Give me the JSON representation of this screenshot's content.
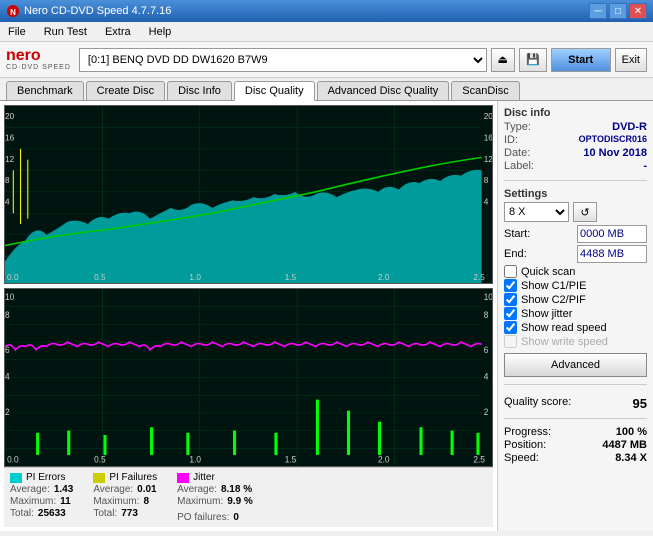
{
  "titlebar": {
    "title": "Nero CD-DVD Speed 4.7.7.16",
    "minimize": "─",
    "maximize": "□",
    "close": "✕"
  },
  "menubar": {
    "items": [
      "File",
      "Run Test",
      "Extra",
      "Help"
    ]
  },
  "toolbar": {
    "logo_main": "nero",
    "logo_sub": "CD·DVD SPEED",
    "drive_value": "[0:1]  BENQ DVD DD DW1620 B7W9",
    "start_label": "Start",
    "exit_label": "Exit"
  },
  "tabs": [
    {
      "label": "Benchmark",
      "active": false
    },
    {
      "label": "Create Disc",
      "active": false
    },
    {
      "label": "Disc Info",
      "active": false
    },
    {
      "label": "Disc Quality",
      "active": true
    },
    {
      "label": "Advanced Disc Quality",
      "active": false
    },
    {
      "label": "ScanDisc",
      "active": false
    }
  ],
  "disc_info": {
    "section": "Disc info",
    "type_key": "Type:",
    "type_val": "DVD-R",
    "id_key": "ID:",
    "id_val": "OPTODISCR016",
    "date_key": "Date:",
    "date_val": "10 Nov 2018",
    "label_key": "Label:",
    "label_val": "-"
  },
  "settings": {
    "section": "Settings",
    "speed": "8 X",
    "start_key": "Start:",
    "start_val": "0000 MB",
    "end_key": "End:",
    "end_val": "4488 MB",
    "quick_scan": "Quick scan",
    "show_c1pie": "Show C1/PIE",
    "show_c2pif": "Show C2/PIF",
    "show_jitter": "Show jitter",
    "show_read_speed": "Show read speed",
    "show_write_speed": "Show write speed",
    "advanced_btn": "Advanced"
  },
  "quality": {
    "score_label": "Quality score:",
    "score_val": "95"
  },
  "progress": {
    "progress_key": "Progress:",
    "progress_val": "100 %",
    "position_key": "Position:",
    "position_val": "4487 MB",
    "speed_key": "Speed:",
    "speed_val": "8.34 X"
  },
  "stats": {
    "pi_errors": {
      "label": "PI Errors",
      "color": "#00cccc",
      "avg_key": "Average:",
      "avg_val": "1.43",
      "max_key": "Maximum:",
      "max_val": "11",
      "total_key": "Total:",
      "total_val": "25633"
    },
    "pi_failures": {
      "label": "PI Failures",
      "color": "#cccc00",
      "avg_key": "Average:",
      "avg_val": "0.01",
      "max_key": "Maximum:",
      "max_val": "8",
      "total_key": "Total:",
      "total_val": "773"
    },
    "jitter": {
      "label": "Jitter",
      "color": "#ff00ff",
      "avg_key": "Average:",
      "avg_val": "8.18 %",
      "max_key": "Maximum:",
      "max_val": "9.9 %"
    },
    "po_failures": {
      "label": "PO failures:",
      "val": "0"
    }
  }
}
